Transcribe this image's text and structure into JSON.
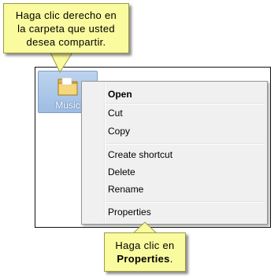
{
  "callout_top": {
    "line1": "Haga clic derecho en",
    "line2": "la carpeta que usted",
    "line3": "desea compartir."
  },
  "folder": {
    "label": "Music",
    "icon": "folder-icon"
  },
  "context_menu": {
    "items": [
      {
        "label": "Open",
        "bold": true
      },
      {
        "label": "Cut"
      },
      {
        "label": "Copy"
      },
      {
        "label": "Create shortcut"
      },
      {
        "label": "Delete"
      },
      {
        "label": "Rename"
      },
      {
        "label": "Properties"
      }
    ]
  },
  "callout_bottom": {
    "line1": "Haga clic en",
    "emphasis": "Properties",
    "suffix": "."
  },
  "colors": {
    "callout_fill": "#fafa9e",
    "menu_bg": "#f0f0f0",
    "folder_highlight": "#9dbde3"
  }
}
